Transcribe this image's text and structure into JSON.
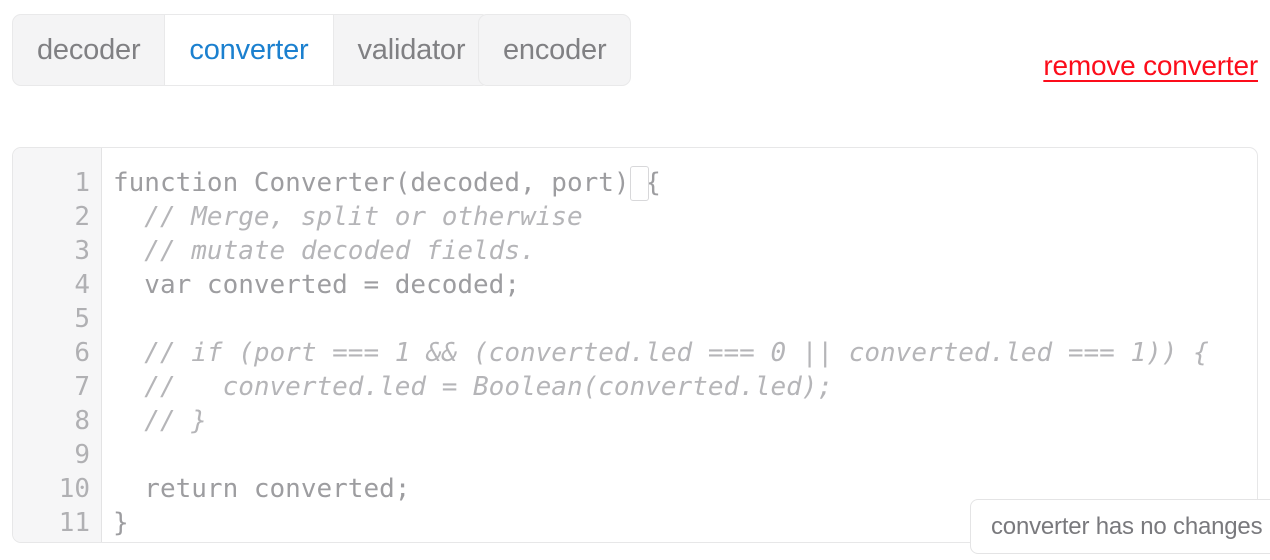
{
  "toolbar": {
    "tab_group": [
      {
        "label": "decoder",
        "active": false
      },
      {
        "label": "converter",
        "active": true
      },
      {
        "label": "validator",
        "active": false
      }
    ],
    "standalone_tab": {
      "label": "encoder"
    },
    "remove_link": "remove converter"
  },
  "editor": {
    "line_numbers": [
      "1",
      "2",
      "3",
      "4",
      "5",
      "6",
      "7",
      "8",
      "9",
      "10",
      "11"
    ],
    "lines": [
      {
        "text": "function Converter(decoded, port) {",
        "comment": false
      },
      {
        "text": "  // Merge, split or otherwise",
        "comment": true
      },
      {
        "text": "  // mutate decoded fields.",
        "comment": true
      },
      {
        "text": "  var converted = decoded;",
        "comment": false
      },
      {
        "text": "",
        "comment": false
      },
      {
        "text": "  // if (port === 1 && (converted.led === 0 || converted.led === 1)) {",
        "comment": true
      },
      {
        "text": "  //   converted.led = Boolean(converted.led);",
        "comment": true
      },
      {
        "text": "  // }",
        "comment": true
      },
      {
        "text": "",
        "comment": false
      },
      {
        "text": "  return converted;",
        "comment": false
      },
      {
        "text": "}",
        "comment": false
      }
    ]
  },
  "tooltip": {
    "text": "converter has no changes"
  },
  "colors": {
    "active_tab_text": "#1b80cf",
    "inactive_tab_text": "#808083",
    "remove_link": "#fc0d1b",
    "code_text": "#9d9da0",
    "comment_text": "#b5b5b8",
    "gutter_bg": "#f6f6f7",
    "tab_group_bg": "#f4f4f5"
  }
}
